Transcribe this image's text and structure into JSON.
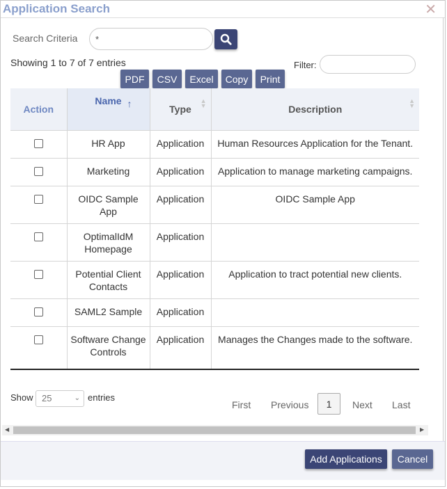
{
  "dialog": {
    "title": "Application Search",
    "close_icon": "close-icon"
  },
  "search": {
    "label": "Search Criteria",
    "value": "*",
    "button_icon": "search-icon"
  },
  "info": {
    "showing": "Showing 1 to 7 of 7 entries",
    "filter_label": "Filter:",
    "filter_value": ""
  },
  "export_buttons": [
    "PDF",
    "CSV",
    "Excel",
    "Copy",
    "Print"
  ],
  "table": {
    "columns": [
      "Action",
      "Name",
      "Type",
      "Description"
    ],
    "sort": {
      "column": "Name",
      "direction": "ascending"
    },
    "rows": [
      {
        "checked": false,
        "name": "HR App",
        "type": "Application",
        "description": "Human Resources Application for the Tenant."
      },
      {
        "checked": false,
        "name": "Marketing",
        "type": "Application",
        "description": "Application to manage marketing campaigns."
      },
      {
        "checked": false,
        "name": "OIDC Sample App",
        "type": "Application",
        "description": "OIDC Sample App"
      },
      {
        "checked": false,
        "name": "OptimalIdM Homepage",
        "type": "Application",
        "description": ""
      },
      {
        "checked": false,
        "name": "Potential Client Contacts",
        "type": "Application",
        "description": "Application to tract potential new clients."
      },
      {
        "checked": false,
        "name": "SAML2 Sample",
        "type": "Application",
        "description": ""
      },
      {
        "checked": false,
        "name": "Software Change Controls",
        "type": "Application",
        "description": "Manages the Changes made to the software."
      }
    ]
  },
  "length": {
    "show_label": "Show",
    "selected": "25",
    "entries_label": "entries"
  },
  "pagination": {
    "first": "First",
    "previous": "Previous",
    "current": "1",
    "next": "Next",
    "last": "Last"
  },
  "footer": {
    "add_label": "Add Applications",
    "cancel_label": "Cancel"
  },
  "colors": {
    "primary_button": "#3b4575",
    "secondary_button": "#5a6792",
    "title": "#8a9fcc"
  }
}
